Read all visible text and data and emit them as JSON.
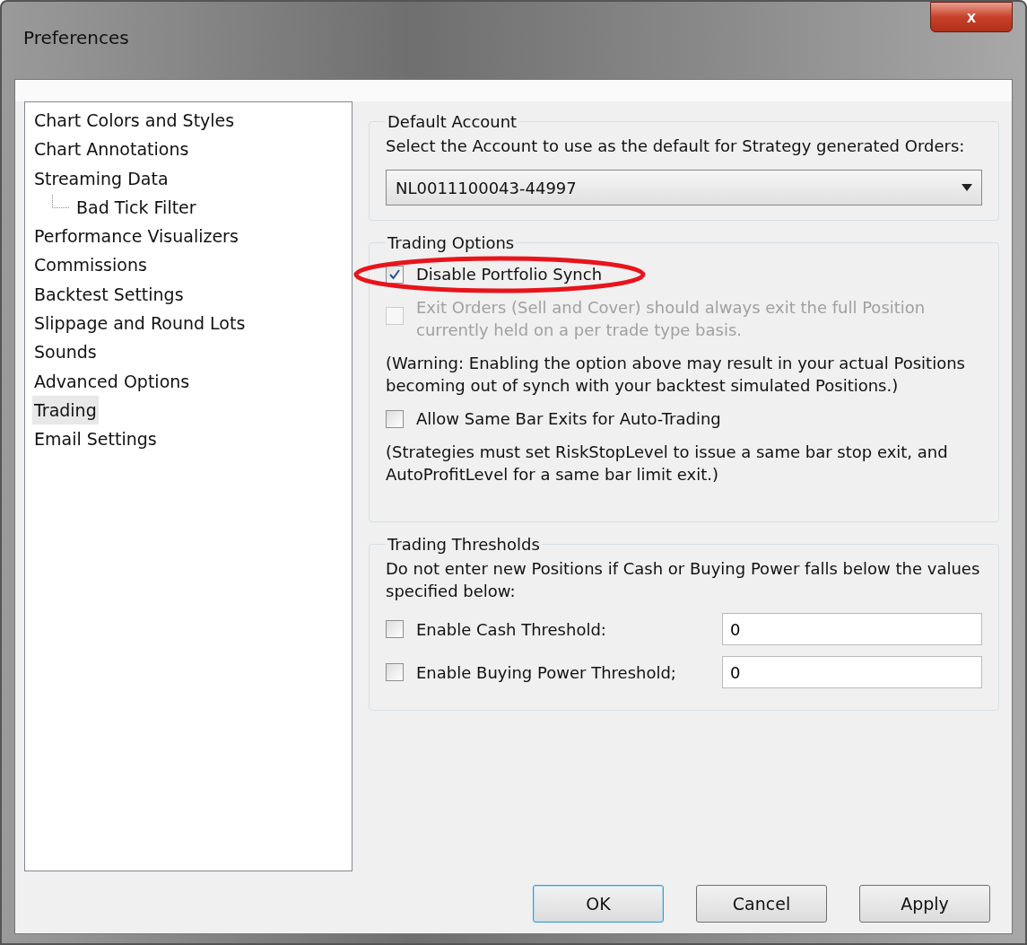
{
  "window": {
    "title": "Preferences",
    "close": "x"
  },
  "tree": [
    {
      "label": "Chart Colors and Styles",
      "selected": false
    },
    {
      "label": "Chart Annotations",
      "selected": false
    },
    {
      "label": "Streaming Data",
      "selected": false,
      "children": [
        {
          "label": "Bad Tick Filter",
          "selected": false
        }
      ]
    },
    {
      "label": "Performance Visualizers",
      "selected": false
    },
    {
      "label": "Commissions",
      "selected": false
    },
    {
      "label": "Backtest Settings",
      "selected": false
    },
    {
      "label": "Slippage and Round Lots",
      "selected": false
    },
    {
      "label": "Sounds",
      "selected": false
    },
    {
      "label": "Advanced Options",
      "selected": false
    },
    {
      "label": "Trading",
      "selected": true
    },
    {
      "label": "Email Settings",
      "selected": false
    }
  ],
  "default_account": {
    "title": "Default Account",
    "description": "Select the Account to use as the default for Strategy generated Orders:",
    "value": "NL0011100043-44997"
  },
  "trading_options": {
    "title": "Trading Options",
    "items": [
      {
        "kind": "checkbox",
        "label": "Disable Portfolio Synch",
        "checked": true,
        "disabled": false,
        "highlighted": true
      },
      {
        "kind": "checkbox",
        "label": "Exit Orders (Sell and Cover) should always exit the full Position currently held on a per trade type basis.",
        "checked": false,
        "disabled": true,
        "highlighted": false
      },
      {
        "kind": "note",
        "label": "(Warning: Enabling the option above may result in your actual Positions becoming out of synch with your backtest simulated Positions.)"
      },
      {
        "kind": "checkbox",
        "label": "Allow Same Bar Exits for Auto-Trading",
        "checked": false,
        "disabled": false,
        "highlighted": false
      },
      {
        "kind": "note",
        "label": "(Strategies must set RiskStopLevel to issue a same bar stop exit, and AutoProfitLevel for a same bar limit exit.)"
      }
    ]
  },
  "trading_thresholds": {
    "title": "Trading Thresholds",
    "description": "Do not enter new Positions if Cash or Buying Power falls below the values specified below:",
    "rows": [
      {
        "label": "Enable Cash Threshold:",
        "checked": false,
        "value": "0"
      },
      {
        "label": "Enable Buying Power Threshold;",
        "checked": false,
        "value": "0"
      }
    ]
  },
  "buttons": [
    {
      "label": "OK",
      "default": true
    },
    {
      "label": "Cancel",
      "default": false
    },
    {
      "label": "Apply",
      "default": false
    }
  ]
}
